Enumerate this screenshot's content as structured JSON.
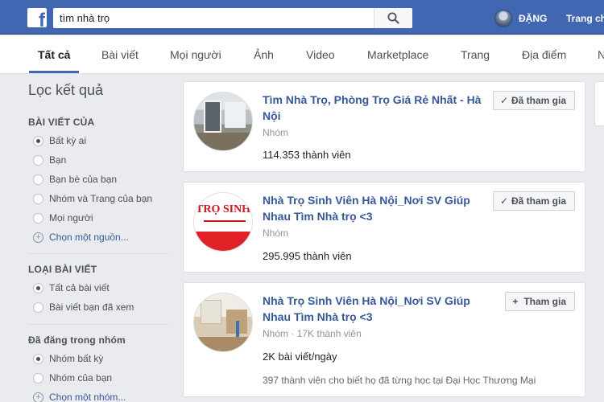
{
  "header": {
    "search_value": "tìm nhà trọ",
    "profile_name": "ĐẶNG",
    "home_label": "Trang ch"
  },
  "tabs": [
    "Tất cả",
    "Bài viết",
    "Mọi người",
    "Ảnh",
    "Video",
    "Marketplace",
    "Trang",
    "Địa điểm",
    "N"
  ],
  "sidebar": {
    "title": "Lọc kết quả",
    "sections": [
      {
        "title": "BÀI VIẾT CỦA",
        "options": [
          "Bất kỳ ai",
          "Bạn",
          "Bạn bè của bạn",
          "Nhóm và Trang của bạn",
          "Mọi người"
        ],
        "selected": 0,
        "more": "Chọn một nguồn..."
      },
      {
        "title": "LOẠI BÀI VIẾT",
        "options": [
          "Tất cả bài viết",
          "Bài viết bạn đã xem"
        ],
        "selected": 0
      },
      {
        "title": "Đã đăng trong nhóm",
        "options": [
          "Nhóm bất kỳ",
          "Nhóm của bạn"
        ],
        "selected": 0,
        "more": "Chọn một nhóm..."
      }
    ]
  },
  "results": [
    {
      "title": "Tìm Nhà Trọ, Phòng Trọ Giá Rẻ Nhất - Hà Nội",
      "meta": "Nhóm",
      "stat": "114.353 thành viên",
      "button": "Đã tham gia",
      "button_icon": "check-icon"
    },
    {
      "title": "Nhà Trọ Sinh Viên Hà Nội_Nơi SV Giúp Nhau Tìm Nhà trọ <3",
      "meta": "Nhóm",
      "stat": "295.995 thành viên",
      "button": "Đã tham gia",
      "button_icon": "check-icon",
      "thumb_text": "TRỌ SINH V"
    },
    {
      "title": "Nhà Trọ Sinh Viên Hà Nội_Nơi SV Giúp Nhau Tìm Nhà trọ <3",
      "meta": "Nhóm · 17K thành viên",
      "stat": "2K bài viết/ngày",
      "note": "397 thành viên cho biết họ đã từng học tại Đại Học Thương Mại",
      "button": "Tham gia",
      "button_icon": "plus-icon"
    }
  ],
  "colors": {
    "brand": "#4267b2",
    "link": "#365899",
    "background": "#e9ebee"
  }
}
